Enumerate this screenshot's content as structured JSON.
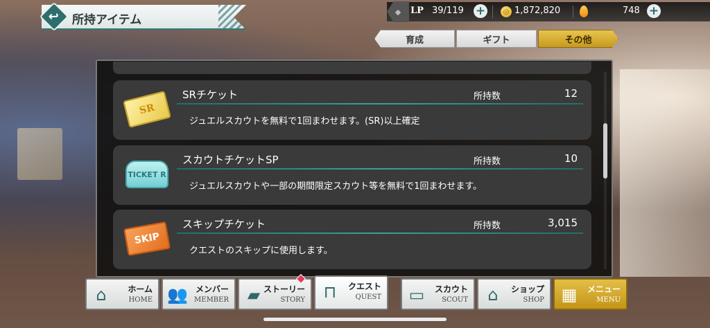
{
  "header": {
    "title": "所持アイテム",
    "back_icon": "↩"
  },
  "currency": {
    "lp_label": "LP",
    "lp_value": "39/119",
    "coins": "1,872,820",
    "jewels": "748",
    "plus": "+"
  },
  "tabs": [
    {
      "label": "育成",
      "active": false
    },
    {
      "label": "ギフト",
      "active": false
    },
    {
      "label": "その他",
      "active": true
    }
  ],
  "items": [
    {
      "name": "SRチケット",
      "count_label": "所持数",
      "count": "12",
      "description": "ジュエルスカウトを無料で1回まわせます。(SR)以上確定",
      "icon_text": "SR",
      "icon": "sr-ticket-icon"
    },
    {
      "name": "スカウトチケットSP",
      "count_label": "所持数",
      "count": "10",
      "description": "ジュエルスカウトや一部の期間限定スカウト等を無料で1回まわせます。",
      "icon_text": "TICKET R",
      "icon": "scout-ticket-sp-icon"
    },
    {
      "name": "スキップチケット",
      "count_label": "所持数",
      "count": "3,015",
      "description": "クエストのスキップに使用します。",
      "icon_text": "SKIP",
      "icon": "skip-ticket-icon"
    }
  ],
  "nav": [
    {
      "jp": "ホーム",
      "en": "HOME",
      "icon": "⌂"
    },
    {
      "jp": "メンバー",
      "en": "MEMBER",
      "icon": "👥"
    },
    {
      "jp": "ストーリー",
      "en": "STORY",
      "icon": "▰"
    },
    {
      "jp": "クエスト",
      "en": "QUEST",
      "icon": "⊓"
    },
    {
      "jp": "スカウト",
      "en": "SCOUT",
      "icon": "▭"
    },
    {
      "jp": "ショップ",
      "en": "SHOP",
      "icon": "⌂"
    },
    {
      "jp": "メニュー",
      "en": "MENU",
      "icon": "▦"
    }
  ],
  "colors": {
    "accent_teal": "#2f7a7a",
    "active_gold": "#c89a1d"
  }
}
